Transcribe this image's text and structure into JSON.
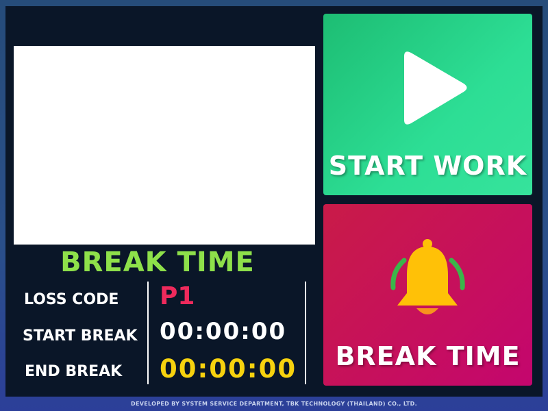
{
  "status": {
    "title": "BREAK TIME"
  },
  "info": {
    "loss_code_label": "LOSS CODE",
    "loss_code_value": "P1",
    "start_break_label": "START BREAK",
    "start_break_value": "00:00:00",
    "end_break_label": "END BREAK",
    "end_break_value": "00:00:00"
  },
  "buttons": {
    "start_work": {
      "label": "START WORK",
      "icon": "play-icon"
    },
    "break_time": {
      "label": "BREAK TIME",
      "icon": "bell-icon"
    }
  },
  "footer": {
    "text": "DEVELOPED BY SYSTEM SERVICE DEPARTMENT, TBK TECHNOLOGY (THAILAND) CO., LTD."
  },
  "colors": {
    "status_title": "#8ee04a",
    "loss_code": "#ee2a5c",
    "end_break_time": "#f7d20e",
    "start_work_button": "#2dde95",
    "break_time_button": "#c60f5e",
    "bell": "#ffc107"
  }
}
